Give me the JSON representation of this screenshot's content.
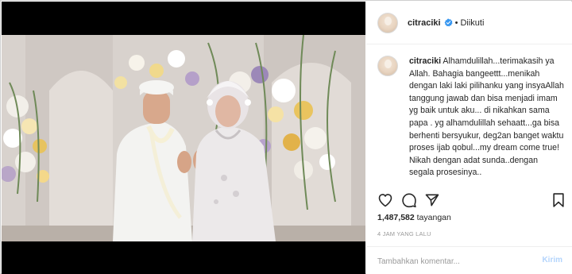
{
  "post": {
    "username": "citraciki",
    "follow_status": "Diikuti",
    "caption_user": "citraciki",
    "caption_text": "Alhamdulillah...terimakasih ya Allah. Bahagia bangeettt...menikah dengan laki laki pilihanku yang insyaAllah tanggung jawab dan bisa menjadi imam yg baik untuk aku... di nikahkan sama papa . yg alhamdulillah sehaatt...ga bisa berhenti bersyukur, deg2an banget waktu proses ijab qobul...my dream come true! Nikah dengan adat sunda..dengan segala prosesinya..",
    "views": "1,487,582",
    "views_label": "tayangan",
    "time_ago": "4 JAM YANG LALU",
    "comment_placeholder": "Tambahkan komentar...",
    "post_button": "Kirim"
  },
  "colors": {
    "verified": "#3897f0",
    "post_button_disabled": "#b3d4fc"
  },
  "icons": [
    "heart-icon",
    "comment-icon",
    "share-icon",
    "bookmark-icon",
    "verified-badge-icon"
  ]
}
